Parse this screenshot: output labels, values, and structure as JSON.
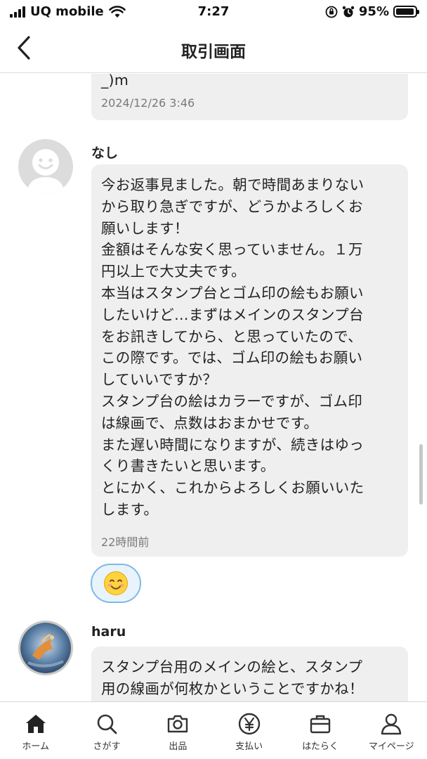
{
  "status_bar": {
    "carrier": "UQ mobile",
    "time": "7:27",
    "battery": "95%",
    "battery_level": 0.95
  },
  "header": {
    "title": "取引画面"
  },
  "messages": [
    {
      "text_partial": "_)m",
      "time": "2024/12/26 3:46"
    },
    {
      "sender": "なし",
      "avatar": "default-avatar",
      "text": "今お返事見ました。朝で時間あまりない\nから取り急ぎですが、どうかよろしくお\n願いします！\n金額はそんな安く思っていません。１万\n円以上で大丈夫です。\n本当はスタンプ台とゴム印の絵もお願い\nしたいけど…まずはメインのスタンプ台\nをお訊きしてから、と思っていたので、\nこの際です。では、ゴム印の絵もお願い\nしていいですか？\nスタンプ台の絵はカラーですが、ゴム印\nは線画で、点数はおまかせです。\nまた遅い時間になりますが、続きはゆっ\nくり書きたいと思います。\nとにかく、これからよろしくお願いいた\nします。",
      "time": "22時間前",
      "reaction": "smiling-face"
    },
    {
      "sender": "haru",
      "avatar": "painting-avatar",
      "text": "スタンプ台用のメインの絵と、スタンプ\n用の線画が何枚かということですかね！"
    }
  ],
  "tabs": [
    {
      "label": "ホーム",
      "icon": "home-icon"
    },
    {
      "label": "さがす",
      "icon": "search-icon"
    },
    {
      "label": "出品",
      "icon": "camera-icon"
    },
    {
      "label": "支払い",
      "icon": "yen-icon"
    },
    {
      "label": "はたらく",
      "icon": "briefcase-icon"
    },
    {
      "label": "マイページ",
      "icon": "person-icon"
    }
  ],
  "colors": {
    "bubble": "#efefef",
    "reaction_border": "#7fb9e4",
    "reaction_bg": "#e8f3fb"
  }
}
